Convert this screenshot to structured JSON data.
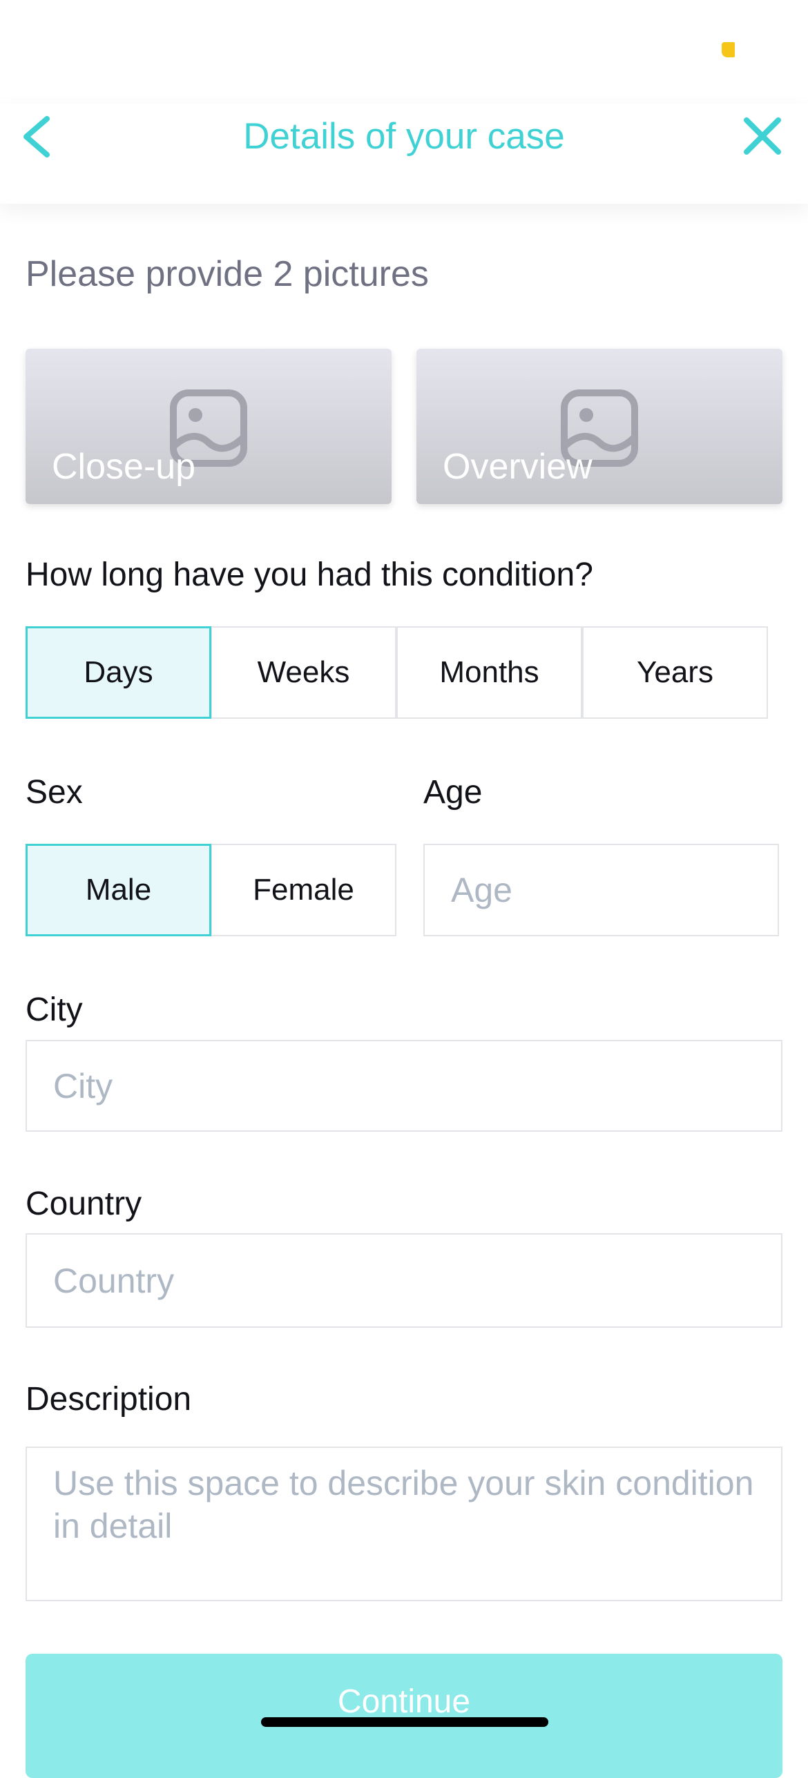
{
  "header": {
    "title": "Details of your case",
    "back_icon": "chevron-left-icon",
    "close_icon": "close-icon"
  },
  "photos": {
    "prompt": "Please provide 2 pictures",
    "items": [
      {
        "label": "Close-up",
        "icon": "image-icon"
      },
      {
        "label": "Overview",
        "icon": "image-icon"
      }
    ]
  },
  "duration": {
    "question": "How long have you had this condition?",
    "options": [
      "Days",
      "Weeks",
      "Months",
      "Years"
    ],
    "selected": "Days"
  },
  "sex": {
    "label": "Sex",
    "options": [
      "Male",
      "Female"
    ],
    "selected": "Male"
  },
  "age": {
    "label": "Age",
    "placeholder": "Age",
    "value": ""
  },
  "city": {
    "label": "City",
    "placeholder": "City",
    "value": ""
  },
  "country": {
    "label": "Country",
    "placeholder": "Country",
    "value": ""
  },
  "description": {
    "label": "Description",
    "placeholder": "Use this space to describe your skin condition in detail",
    "value": ""
  },
  "continue_label": "Continue",
  "colors": {
    "accent": "#3fd1d3",
    "selected_bg": "#e6f8f9",
    "continue_bg": "#8ceae9",
    "placeholder": "#aeb8c4",
    "battery": "#f5c518"
  }
}
